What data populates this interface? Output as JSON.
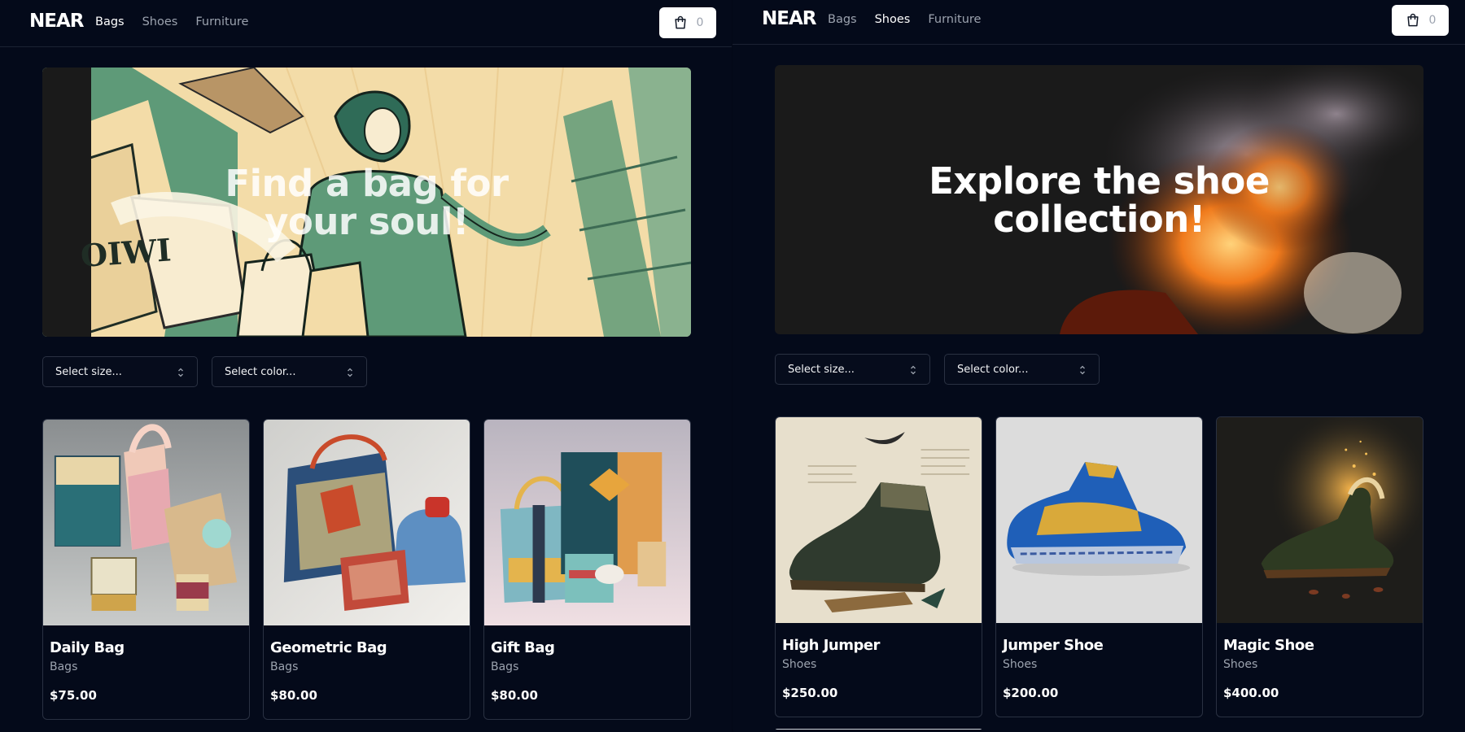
{
  "left": {
    "logo": "NEAR",
    "nav": [
      "Bags",
      "Shoes",
      "Furniture"
    ],
    "active_nav": "Bags",
    "cart_count": "0",
    "hero_title": "Find a bag for your soul!",
    "selects": {
      "size": "Select size...",
      "color": "Select color..."
    },
    "products": [
      {
        "name": "Daily Bag",
        "category": "Bags",
        "price": "$75.00"
      },
      {
        "name": "Geometric Bag",
        "category": "Bags",
        "price": "$80.00"
      },
      {
        "name": "Gift Bag",
        "category": "Bags",
        "price": "$80.00"
      }
    ]
  },
  "right": {
    "logo": "NEAR",
    "nav": [
      "Bags",
      "Shoes",
      "Furniture"
    ],
    "active_nav": "Shoes",
    "cart_count": "0",
    "hero_title": "Explore the shoe collection!",
    "selects": {
      "size": "Select size...",
      "color": "Select color..."
    },
    "products": [
      {
        "name": "High Jumper",
        "category": "Shoes",
        "price": "$250.00"
      },
      {
        "name": "Jumper Shoe",
        "category": "Shoes",
        "price": "$200.00"
      },
      {
        "name": "Magic Shoe",
        "category": "Shoes",
        "price": "$400.00"
      }
    ]
  },
  "icons": {
    "cart": "shopping-bag-icon",
    "select_chevron": "chevron-up-down-icon"
  },
  "colors": {
    "background": "#040a1a",
    "card_border": "#2a3142",
    "muted_text": "#9ca3af",
    "cart_button_bg": "#ffffff"
  }
}
